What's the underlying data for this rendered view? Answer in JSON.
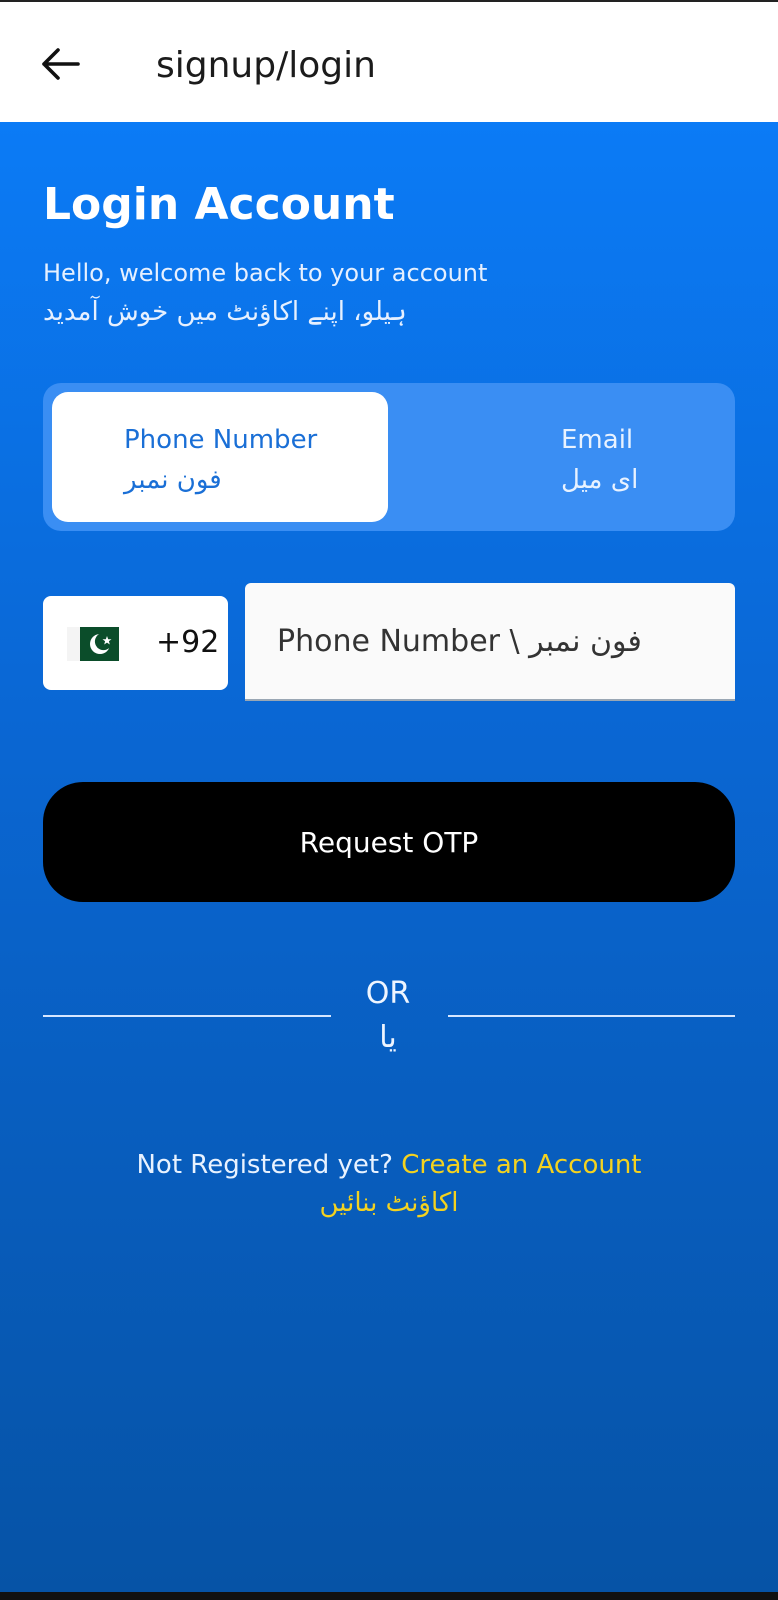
{
  "app_bar": {
    "title": "signup/login",
    "back_icon": "arrow-left-icon"
  },
  "header": {
    "title": "Login Account",
    "subtitle_en": "Hello, welcome back to your account",
    "subtitle_ur": "ہیلو، اپنے اکاؤنٹ میں خوش آمدید"
  },
  "tabs": [
    {
      "label_en": "Phone Number",
      "label_ur": "فون نمبر",
      "active": true
    },
    {
      "label_en": "Email",
      "label_ur": "ای میل",
      "active": false
    }
  ],
  "phone": {
    "flag_icon": "pakistan-flag-icon",
    "country_code": "+92",
    "placeholder": "Phone Number \\ فون نمبر"
  },
  "actions": {
    "request_otp_label": "Request OTP"
  },
  "divider": {
    "or_en": "OR",
    "or_ur": "یا"
  },
  "register": {
    "prompt": "Not Registered yet?",
    "link_en": "Create an Account",
    "link_ur": "اکاؤنٹ بنائیں"
  },
  "colors": {
    "primary_blue": "#0b7bf6",
    "tab_bg": "#3a8ef3",
    "link_yellow": "#f4d21f",
    "button_black": "#000000"
  }
}
